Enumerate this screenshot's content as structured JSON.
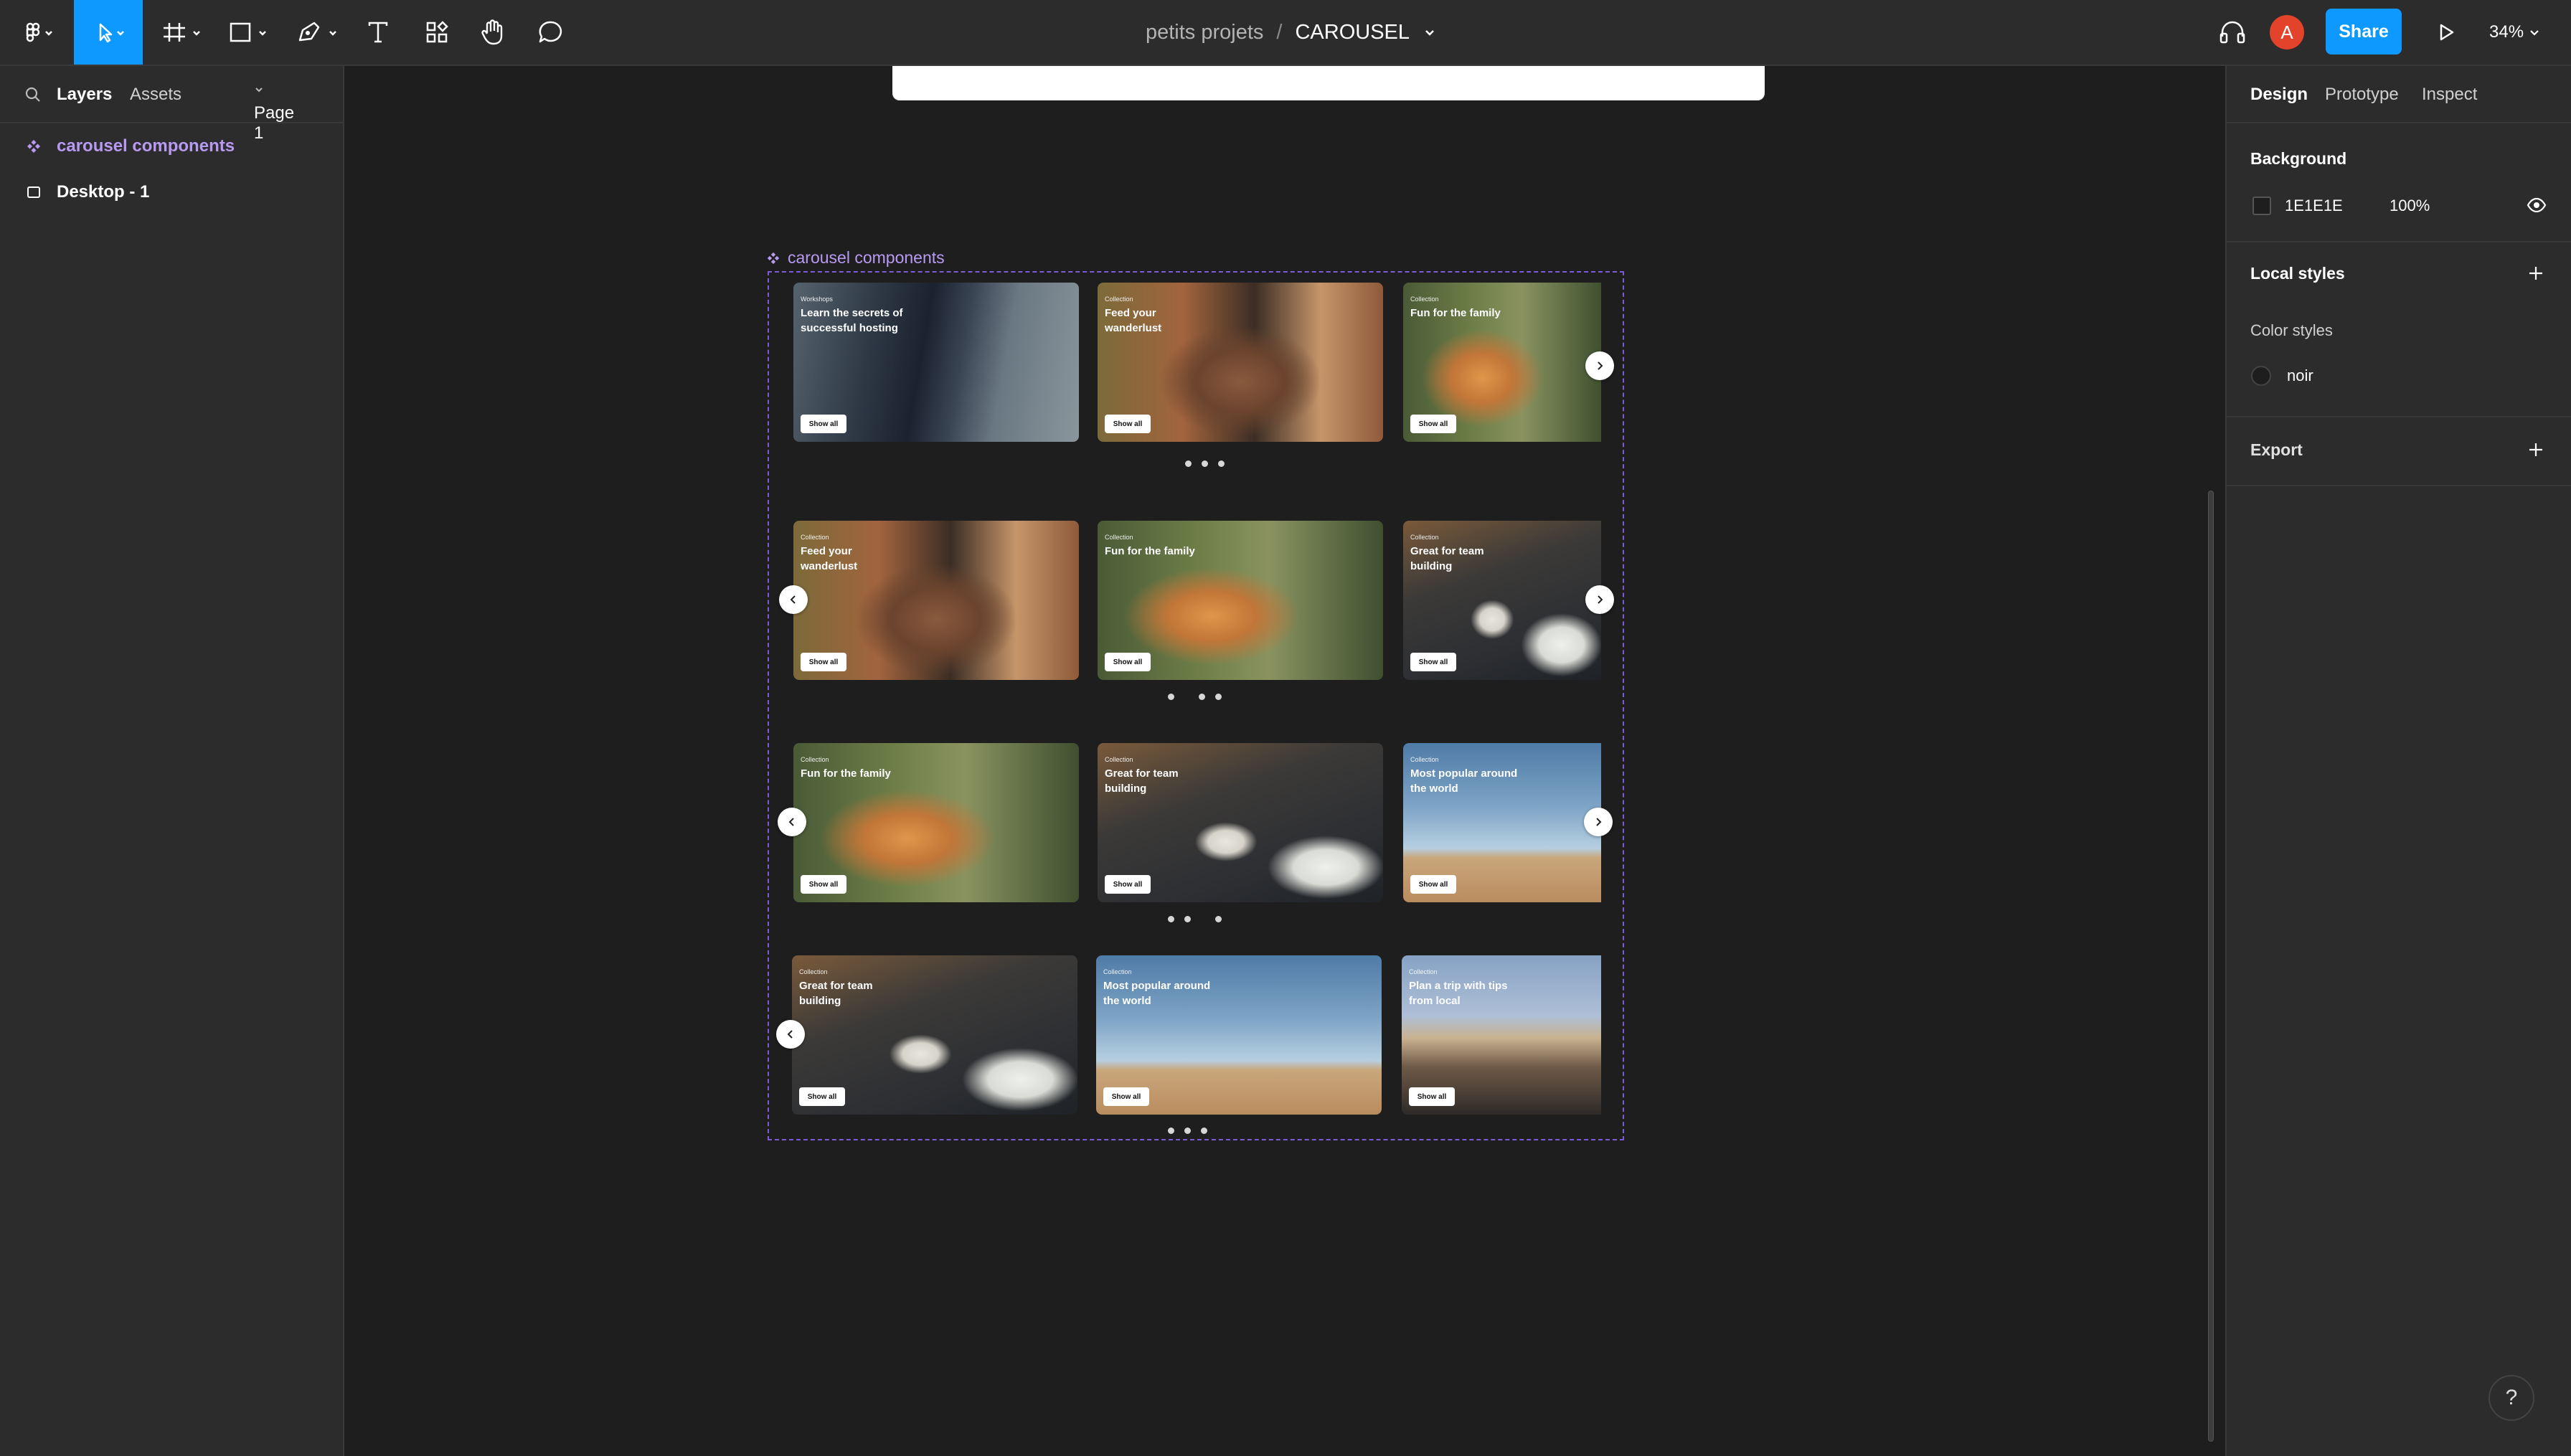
{
  "header": {
    "project": "petits projets",
    "separator": "/",
    "file": "CAROUSEL",
    "avatar_initial": "A",
    "share_label": "Share",
    "zoom": "34%"
  },
  "left_panel": {
    "tabs": [
      "Layers",
      "Assets"
    ],
    "page_selector": "Page 1",
    "layers": [
      {
        "label": "carousel components",
        "type": "component"
      },
      {
        "label": "Desktop - 1",
        "type": "frame"
      }
    ]
  },
  "right_panel": {
    "tabs": [
      "Design",
      "Prototype",
      "Inspect"
    ],
    "background_title": "Background",
    "background_hex": "1E1E1E",
    "background_opacity": "100%",
    "local_styles_title": "Local styles",
    "color_styles_title": "Color styles",
    "color_style_name": "noir",
    "export_title": "Export"
  },
  "canvas": {
    "component_label": "carousel components",
    "rows": [
      {
        "cards": [
          {
            "tag": "Workshops",
            "title": "Learn the secrets of successful hosting",
            "button": "Show all",
            "image": "suit"
          },
          {
            "tag": "Collection",
            "title": "Feed your wanderlust",
            "button": "Show all",
            "image": "man"
          },
          {
            "tag": "Collection",
            "title": "Fun for the family",
            "button": "Show all",
            "image": "kid"
          }
        ]
      },
      {
        "cards": [
          {
            "tag": "Collection",
            "title": "Feed your wanderlust",
            "button": "Show all",
            "image": "man"
          },
          {
            "tag": "Collection",
            "title": "Fun for the family",
            "button": "Show all",
            "image": "kid"
          },
          {
            "tag": "Collection",
            "title": "Great for team building",
            "button": "Show all",
            "image": "team"
          }
        ]
      },
      {
        "cards": [
          {
            "tag": "Collection",
            "title": "Fun for the family",
            "button": "Show all",
            "image": "kid"
          },
          {
            "tag": "Collection",
            "title": "Great for team building",
            "button": "Show all",
            "image": "team"
          },
          {
            "tag": "Collection",
            "title": "Most popular around the world",
            "button": "Show all",
            "image": "desert"
          }
        ]
      },
      {
        "cards": [
          {
            "tag": "Collection",
            "title": "Great for team building",
            "button": "Show all",
            "image": "team"
          },
          {
            "tag": "Collection",
            "title": "Most popular around the world",
            "button": "Show all",
            "image": "desert"
          },
          {
            "tag": "Collection",
            "title": "Plan a trip with tips from local",
            "button": "Show all",
            "image": "city"
          }
        ]
      }
    ]
  },
  "help_label": "?",
  "colors": {
    "accent": "#0d99ff",
    "component": "#b99af2",
    "panel": "#2c2c2c",
    "canvas": "#1e1e1e",
    "avatar": "#e2432a"
  },
  "icons": [
    "figma-menu-icon",
    "move-tool-icon",
    "frame-tool-icon",
    "shape-tool-icon",
    "pen-tool-icon",
    "text-tool-icon",
    "resources-icon",
    "hand-tool-icon",
    "comment-icon",
    "headphones-icon",
    "play-icon",
    "search-icon",
    "component-icon",
    "frame-icon",
    "eye-icon",
    "plus-icon",
    "chevron-left-icon",
    "chevron-right-icon",
    "help-icon"
  ]
}
